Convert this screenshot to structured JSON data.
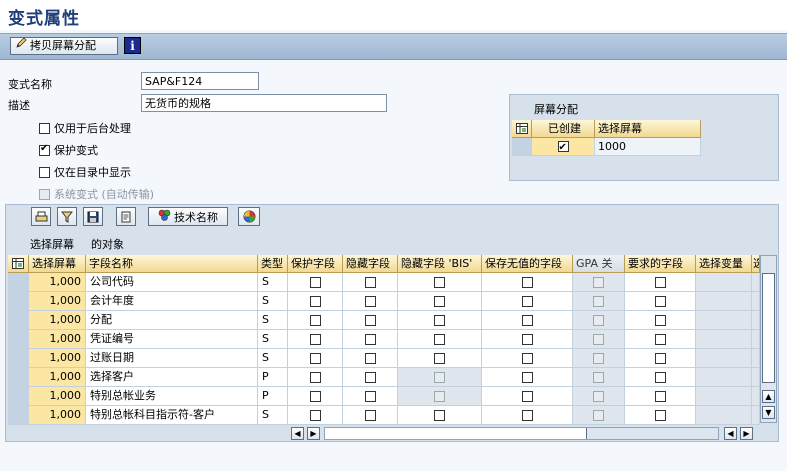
{
  "window": {
    "title": "变式属性"
  },
  "toolbar": {
    "copy_button_label": "拷贝屏幕分配",
    "info_icon": "i"
  },
  "form": {
    "variant_label": "变式名称",
    "variant_value": "SAP&F124",
    "desc_label": "描述",
    "desc_value": "无货币的规格",
    "checkboxes": [
      {
        "label": "仅用于后台处理",
        "checked": false,
        "disabled": false
      },
      {
        "label": "保护变式",
        "checked": true,
        "disabled": false
      },
      {
        "label": "仅在目录中显示",
        "checked": false,
        "disabled": false
      },
      {
        "label": "系统变式 (自动传输)",
        "checked": false,
        "disabled": true
      }
    ]
  },
  "screen_assignment": {
    "title": "屏幕分配",
    "headers": [
      "已创建",
      "选择屏幕"
    ],
    "rows": [
      {
        "created": true,
        "screen": "1000"
      }
    ]
  },
  "panel": {
    "tech_name_button": "技术名称",
    "caption_a": "选择屏幕",
    "caption_b": "的对象",
    "columns": [
      "选择屏幕",
      "字段名称",
      "类型",
      "保护字段",
      "隐藏字段",
      "隐藏字段 'BIS'",
      "保存无值的字段",
      "GPA 关",
      "要求的字段",
      "选择变量",
      "选"
    ],
    "rows": [
      {
        "screen": "1,000",
        "field": "公司代码",
        "type": "S",
        "bis_disabled": false
      },
      {
        "screen": "1,000",
        "field": "会计年度",
        "type": "S",
        "bis_disabled": false
      },
      {
        "screen": "1,000",
        "field": "分配",
        "type": "S",
        "bis_disabled": false
      },
      {
        "screen": "1,000",
        "field": "凭证编号",
        "type": "S",
        "bis_disabled": false
      },
      {
        "screen": "1,000",
        "field": "过账日期",
        "type": "S",
        "bis_disabled": false
      },
      {
        "screen": "1,000",
        "field": "选择客户",
        "type": "P",
        "bis_disabled": true
      },
      {
        "screen": "1,000",
        "field": "特别总帐业务",
        "type": "P",
        "bis_disabled": true
      },
      {
        "screen": "1,000",
        "field": "特别总帐科目指示符-客户",
        "type": "S",
        "bis_disabled": false
      }
    ]
  },
  "colors": {
    "title": "#1f3f7a",
    "header_gold": "#f2d991",
    "selected_cell": "#fbe7a3",
    "panel_bg": "#d6e1ec"
  }
}
